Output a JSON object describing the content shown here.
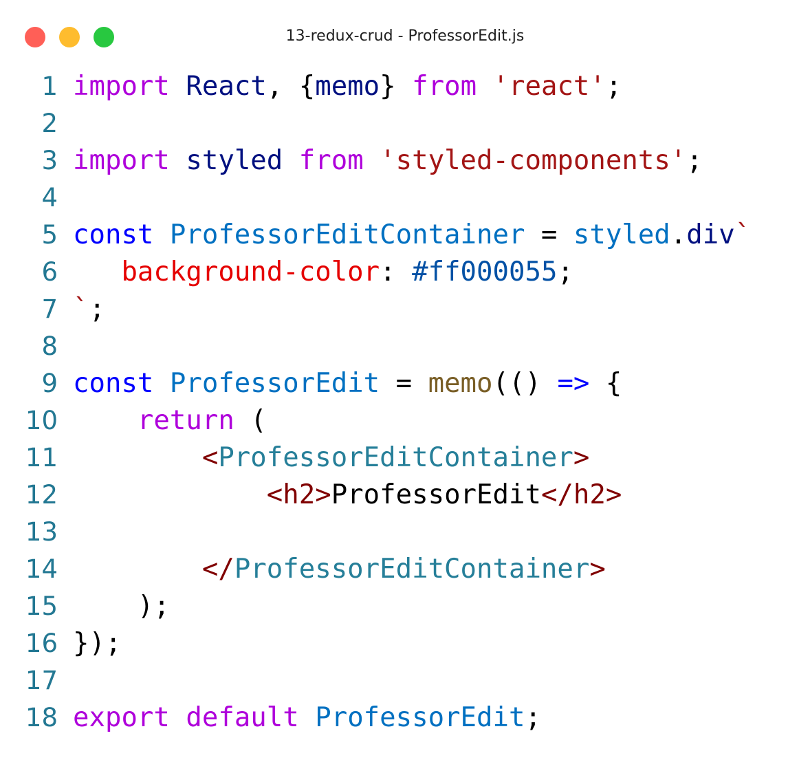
{
  "window": {
    "title": "13-redux-crud - ProfessorEdit.js"
  },
  "colors": {
    "close": "#ff5f57",
    "minimize": "#febc2e",
    "zoom": "#28c840",
    "line_number": "#237893",
    "keyword_control": "#af00db",
    "keyword": "#0000ff",
    "identifier": "#001080",
    "string": "#a31515",
    "constant": "#0070c1",
    "function": "#795e26",
    "css_property": "#e50000",
    "css_value": "#0451a5",
    "tag": "#800000",
    "component": "#267f99"
  },
  "code": {
    "lines": [
      {
        "number": "1",
        "tokens": [
          {
            "t": "import",
            "k": "keyword-ctrl"
          },
          {
            "t": " ",
            "k": "plain"
          },
          {
            "t": "React",
            "k": "ident"
          },
          {
            "t": ", {",
            "k": "plain"
          },
          {
            "t": "memo",
            "k": "ident"
          },
          {
            "t": "} ",
            "k": "plain"
          },
          {
            "t": "from",
            "k": "keyword-ctrl"
          },
          {
            "t": " ",
            "k": "plain"
          },
          {
            "t": "'react'",
            "k": "string"
          },
          {
            "t": ";",
            "k": "plain"
          }
        ]
      },
      {
        "number": "2",
        "tokens": []
      },
      {
        "number": "3",
        "tokens": [
          {
            "t": "import",
            "k": "keyword-ctrl"
          },
          {
            "t": " ",
            "k": "plain"
          },
          {
            "t": "styled",
            "k": "ident"
          },
          {
            "t": " ",
            "k": "plain"
          },
          {
            "t": "from",
            "k": "keyword-ctrl"
          },
          {
            "t": " ",
            "k": "plain"
          },
          {
            "t": "'styled-components'",
            "k": "string"
          },
          {
            "t": ";",
            "k": "plain"
          }
        ]
      },
      {
        "number": "4",
        "tokens": []
      },
      {
        "number": "5",
        "tokens": [
          {
            "t": "const",
            "k": "keyword"
          },
          {
            "t": " ",
            "k": "plain"
          },
          {
            "t": "ProfessorEditContainer",
            "k": "const"
          },
          {
            "t": " = ",
            "k": "plain"
          },
          {
            "t": "styled",
            "k": "const"
          },
          {
            "t": ".",
            "k": "plain"
          },
          {
            "t": "div",
            "k": "ident"
          },
          {
            "t": "`",
            "k": "string"
          }
        ]
      },
      {
        "number": "6",
        "tokens": [
          {
            "t": "   ",
            "k": "plain"
          },
          {
            "t": "background-color",
            "k": "css-prop"
          },
          {
            "t": ": ",
            "k": "plain"
          },
          {
            "t": "#ff000055",
            "k": "css-val"
          },
          {
            "t": ";",
            "k": "plain"
          }
        ]
      },
      {
        "number": "7",
        "tokens": [
          {
            "t": "`",
            "k": "string"
          },
          {
            "t": ";",
            "k": "plain"
          }
        ]
      },
      {
        "number": "8",
        "tokens": []
      },
      {
        "number": "9",
        "tokens": [
          {
            "t": "const",
            "k": "keyword"
          },
          {
            "t": " ",
            "k": "plain"
          },
          {
            "t": "ProfessorEdit",
            "k": "const"
          },
          {
            "t": " = ",
            "k": "plain"
          },
          {
            "t": "memo",
            "k": "func"
          },
          {
            "t": "(() ",
            "k": "plain"
          },
          {
            "t": "=>",
            "k": "keyword"
          },
          {
            "t": " {",
            "k": "plain"
          }
        ]
      },
      {
        "number": "10",
        "tokens": [
          {
            "t": "    ",
            "k": "plain"
          },
          {
            "t": "return",
            "k": "keyword-ctrl"
          },
          {
            "t": " (",
            "k": "plain"
          }
        ]
      },
      {
        "number": "11",
        "tokens": [
          {
            "t": "        ",
            "k": "plain"
          },
          {
            "t": "<",
            "k": "tag-bracket"
          },
          {
            "t": "ProfessorEditContainer",
            "k": "component"
          },
          {
            "t": ">",
            "k": "tag-bracket"
          }
        ]
      },
      {
        "number": "12",
        "tokens": [
          {
            "t": "            ",
            "k": "plain"
          },
          {
            "t": "<",
            "k": "tag-bracket"
          },
          {
            "t": "h2",
            "k": "tag"
          },
          {
            "t": ">",
            "k": "tag-bracket"
          },
          {
            "t": "ProfessorEdit",
            "k": "plain"
          },
          {
            "t": "</",
            "k": "tag-bracket"
          },
          {
            "t": "h2",
            "k": "tag"
          },
          {
            "t": ">",
            "k": "tag-bracket"
          }
        ]
      },
      {
        "number": "13",
        "tokens": []
      },
      {
        "number": "14",
        "tokens": [
          {
            "t": "        ",
            "k": "plain"
          },
          {
            "t": "</",
            "k": "tag-bracket"
          },
          {
            "t": "ProfessorEditContainer",
            "k": "component"
          },
          {
            "t": ">",
            "k": "tag-bracket"
          }
        ]
      },
      {
        "number": "15",
        "tokens": [
          {
            "t": "    );",
            "k": "plain"
          }
        ]
      },
      {
        "number": "16",
        "tokens": [
          {
            "t": "});",
            "k": "plain"
          }
        ]
      },
      {
        "number": "17",
        "tokens": []
      },
      {
        "number": "18",
        "tokens": [
          {
            "t": "export",
            "k": "keyword-ctrl"
          },
          {
            "t": " ",
            "k": "plain"
          },
          {
            "t": "default",
            "k": "keyword-ctrl"
          },
          {
            "t": " ",
            "k": "plain"
          },
          {
            "t": "ProfessorEdit",
            "k": "const"
          },
          {
            "t": ";",
            "k": "plain"
          }
        ]
      }
    ]
  }
}
